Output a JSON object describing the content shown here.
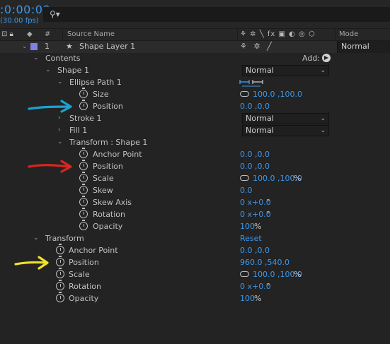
{
  "timecode": ":0:00:00",
  "fps": "(30.00 fps)",
  "search": {
    "placeholder": ""
  },
  "header": {
    "number_col": "#",
    "source_name": "Source Name",
    "switch_icons": "⚘ ✲ ╲ fx ▣ ◐ ◎ ⬡",
    "mode": "Mode"
  },
  "layer": {
    "number": "1",
    "name": "Shape Layer 1",
    "mode": "Normal",
    "switches": "⚘ ✲ ╱"
  },
  "contents": {
    "label": "Contents",
    "add_label": "Add:"
  },
  "shape1": {
    "label": "Shape 1",
    "mode": "Normal"
  },
  "ellipse": {
    "label": "Ellipse Path 1",
    "size_label": "Size",
    "size_value": "100.0 ,100.0",
    "position_label": "Position",
    "position_value": "0.0 ,0.0"
  },
  "stroke": {
    "label": "Stroke 1",
    "mode": "Normal"
  },
  "fill": {
    "label": "Fill 1",
    "mode": "Normal"
  },
  "shape_transform": {
    "label": "Transform : Shape 1",
    "anchor_label": "Anchor Point",
    "anchor_value": "0.0 ,0.0",
    "position_label": "Position",
    "position_value": "0.0 ,0.0",
    "scale_label": "Scale",
    "scale_value": "100.0 ,100.0",
    "scale_unit": "%",
    "skew_label": "Skew",
    "skew_value": "0.0",
    "skew_axis_label": "Skew Axis",
    "skew_axis_value": "0 x+0.0",
    "rotation_label": "Rotation",
    "rotation_value": "0 x+0.0",
    "opacity_label": "Opacity",
    "opacity_value": "100",
    "opacity_unit": "%",
    "degree": "°"
  },
  "layer_transform": {
    "label": "Transform",
    "reset_label": "Reset",
    "anchor_label": "Anchor Point",
    "anchor_value": "0.0 ,0.0",
    "position_label": "Position",
    "position_value": "960.0 ,540.0",
    "scale_label": "Scale",
    "scale_value": "100.0 ,100.0",
    "scale_unit": "%",
    "rotation_label": "Rotation",
    "rotation_value": "0 x+0.0",
    "opacity_label": "Opacity",
    "opacity_value": "100",
    "opacity_unit": "%",
    "degree": "°"
  },
  "annotation_colors": {
    "cyan": "#1aa3d1",
    "red": "#d8261e",
    "yellow": "#f2e02a"
  },
  "accent": "#3e97e8"
}
